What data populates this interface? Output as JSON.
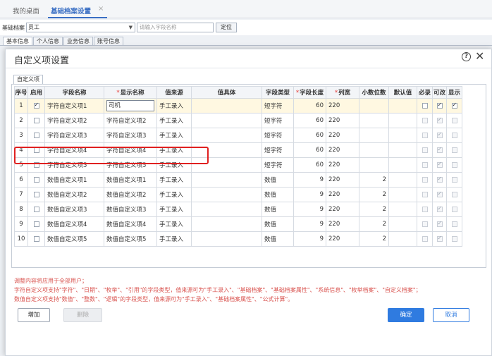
{
  "topbar": {
    "tab_desk": "我的桌面",
    "tab_basic": "基础档案设置",
    "close": "×"
  },
  "filter": {
    "label": "基础档案",
    "selected": "员工",
    "search_placeholder": "请输入字段名称",
    "locate_button": "定位"
  },
  "subtabs": [
    "基本信息",
    "个人信息",
    "业务信息",
    "账号信息"
  ],
  "modal": {
    "title": "自定义项设置",
    "inner_tab": "自定义项",
    "columns": {
      "seq": "序号",
      "enabled": "启用",
      "field_name": "字段名称",
      "display_name": "显示名称",
      "value_source": "值来源",
      "value_body": "值具体",
      "field_type": "字段类型",
      "field_length": "字段长度",
      "col_width": "列宽",
      "decimals": "小数位数",
      "default": "默认值",
      "required": "必录",
      "editable": "可改",
      "visible": "显示"
    },
    "rows": [
      {
        "seq": "1",
        "enabled": true,
        "field_name": "字符自定义项1",
        "display_name": "司机",
        "value_source": "手工录入",
        "value_body": "",
        "field_type": "短字符",
        "length": "60",
        "width": "220",
        "decimals": "",
        "default": "",
        "required": false,
        "editable": true,
        "visible": true
      },
      {
        "seq": "2",
        "enabled": false,
        "field_name": "字符自定义项2",
        "display_name": "字符自定义项2",
        "value_source": "手工录入",
        "value_body": "",
        "field_type": "短字符",
        "length": "60",
        "width": "220",
        "decimals": "",
        "default": "",
        "required": false,
        "editable": true,
        "visible": false
      },
      {
        "seq": "3",
        "enabled": false,
        "field_name": "字符自定义项3",
        "display_name": "字符自定义项3",
        "value_source": "手工录入",
        "value_body": "",
        "field_type": "短字符",
        "length": "60",
        "width": "220",
        "decimals": "",
        "default": "",
        "required": false,
        "editable": true,
        "visible": false
      },
      {
        "seq": "4",
        "enabled": false,
        "field_name": "字符自定义项4",
        "display_name": "字符自定义项4",
        "value_source": "手工录入",
        "value_body": "",
        "field_type": "短字符",
        "length": "60",
        "width": "220",
        "decimals": "",
        "default": "",
        "required": false,
        "editable": true,
        "visible": false
      },
      {
        "seq": "5",
        "enabled": false,
        "field_name": "字符自定义项5",
        "display_name": "字符自定义项5",
        "value_source": "手工录入",
        "value_body": "",
        "field_type": "短字符",
        "length": "60",
        "width": "220",
        "decimals": "",
        "default": "",
        "required": false,
        "editable": true,
        "visible": false
      },
      {
        "seq": "6",
        "enabled": false,
        "field_name": "数值自定义项1",
        "display_name": "数值自定义项1",
        "value_source": "手工录入",
        "value_body": "",
        "field_type": "数值",
        "length": "9",
        "width": "220",
        "decimals": "2",
        "default": "",
        "required": false,
        "editable": true,
        "visible": false
      },
      {
        "seq": "7",
        "enabled": false,
        "field_name": "数值自定义项2",
        "display_name": "数值自定义项2",
        "value_source": "手工录入",
        "value_body": "",
        "field_type": "数值",
        "length": "9",
        "width": "220",
        "decimals": "2",
        "default": "",
        "required": false,
        "editable": true,
        "visible": false
      },
      {
        "seq": "8",
        "enabled": false,
        "field_name": "数值自定义项3",
        "display_name": "数值自定义项3",
        "value_source": "手工录入",
        "value_body": "",
        "field_type": "数值",
        "length": "9",
        "width": "220",
        "decimals": "2",
        "default": "",
        "required": false,
        "editable": true,
        "visible": false
      },
      {
        "seq": "9",
        "enabled": false,
        "field_name": "数值自定义项4",
        "display_name": "数值自定义项4",
        "value_source": "手工录入",
        "value_body": "",
        "field_type": "数值",
        "length": "9",
        "width": "220",
        "decimals": "2",
        "default": "",
        "required": false,
        "editable": true,
        "visible": false
      },
      {
        "seq": "10",
        "enabled": false,
        "field_name": "数值自定义项5",
        "display_name": "数值自定义项5",
        "value_source": "手工录入",
        "value_body": "",
        "field_type": "数值",
        "length": "9",
        "width": "220",
        "decimals": "2",
        "default": "",
        "required": false,
        "editable": true,
        "visible": false
      }
    ],
    "notes": [
      "调整内容将应用于全部用户；",
      "字符自定义项支持\"字符\"、\"日期\"、\"枚举\"、\"引用\"的字段类型，值来源可为\"手工录入\"、\"基础档案\"、\"基础档案属性\"、\"系统信息\"、\"枚举档案\"、\"自定义档案\"；",
      "数值自定义项支持\"数值\"、\"整数\"、\"逻辑\"的字段类型，值来源可为\"手工录入\"、\"基础档案属性\"、\"公式计算\"。"
    ],
    "buttons": {
      "add": "增加",
      "delete": "删除",
      "ok": "确定",
      "cancel": "取消"
    }
  },
  "colors": {
    "accent": "#2f7be0",
    "highlight_border": "#e02020",
    "selected_row": "#fff8e1",
    "note_text": "#d9534f"
  }
}
